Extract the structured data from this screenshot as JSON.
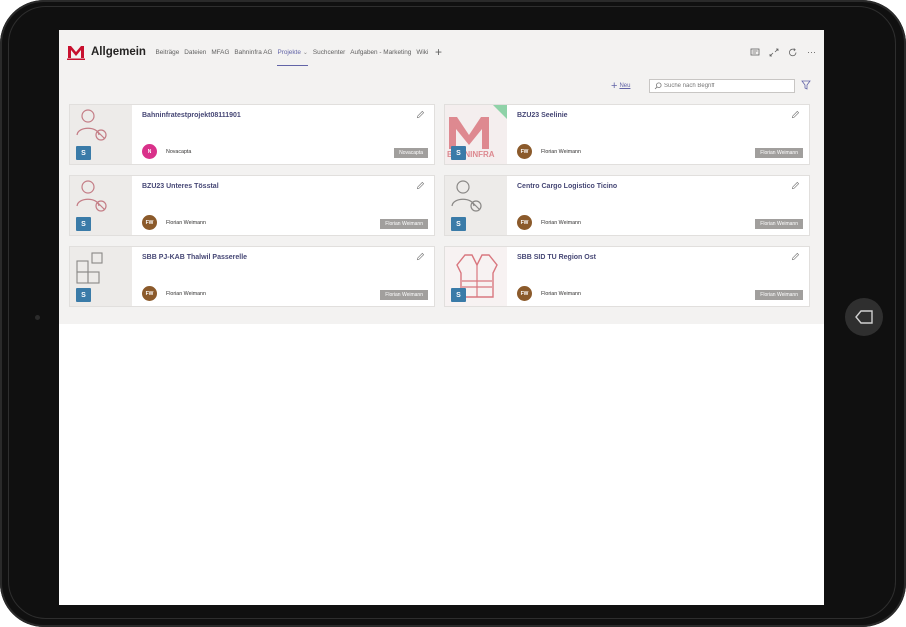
{
  "team": {
    "name": "Allgemein"
  },
  "tabs": [
    {
      "label": "Beiträge",
      "active": false
    },
    {
      "label": "Dateien",
      "active": false
    },
    {
      "label": "MFAG",
      "active": false
    },
    {
      "label": "Bahninfra AG",
      "active": false
    },
    {
      "label": "Projekte",
      "active": true
    },
    {
      "label": "Suchcenter",
      "active": false
    },
    {
      "label": "Aufgaben - Marketing",
      "active": false
    },
    {
      "label": "Wiki",
      "active": false
    }
  ],
  "toolbar": {
    "new_label": "Neu",
    "search_placeholder": "Suche nach Begriff"
  },
  "cards": [
    {
      "title": "Bahninfratestprojekt08111901",
      "initials": "N",
      "owner": "Novacapta",
      "tag": "Novacapta",
      "avatar_color": "#d9318a",
      "thumb": "user-blocked-icon"
    },
    {
      "title": "BZU23 Seelinie",
      "initials": "FW",
      "owner": "Florian Weimann",
      "tag": "Florian Weimann",
      "avatar_color": "#8b5a2b",
      "thumb": "bahninfra-logo",
      "logo_text": "BAHNINFRA"
    },
    {
      "title": "BZU23 Unteres Tösstal",
      "initials": "FW",
      "owner": "Florian Weimann",
      "tag": "Florian Weimann",
      "avatar_color": "#8b5a2b",
      "thumb": "user-blocked-icon"
    },
    {
      "title": "Centro Cargo Logistico Ticino",
      "initials": "FW",
      "owner": "Florian Weimann",
      "tag": "Florian Weimann",
      "avatar_color": "#8b5a2b",
      "thumb": "user-blocked-icon"
    },
    {
      "title": "SBB PJ-KAB Thalwil Passerelle",
      "initials": "FW",
      "owner": "Florian Weimann",
      "tag": "Florian Weimann",
      "avatar_color": "#8b5a2b",
      "thumb": "apps-grid-icon"
    },
    {
      "title": "SBB SID TU Region Ost",
      "initials": "FW",
      "owner": "Florian Weimann",
      "tag": "Florian Weimann",
      "avatar_color": "#8b5a2b",
      "thumb": "safety-vest-icon"
    }
  ],
  "colors": {
    "accent": "#6264a7",
    "tag_bg": "#a19f9d",
    "sharepoint": "#3a7ba8"
  }
}
